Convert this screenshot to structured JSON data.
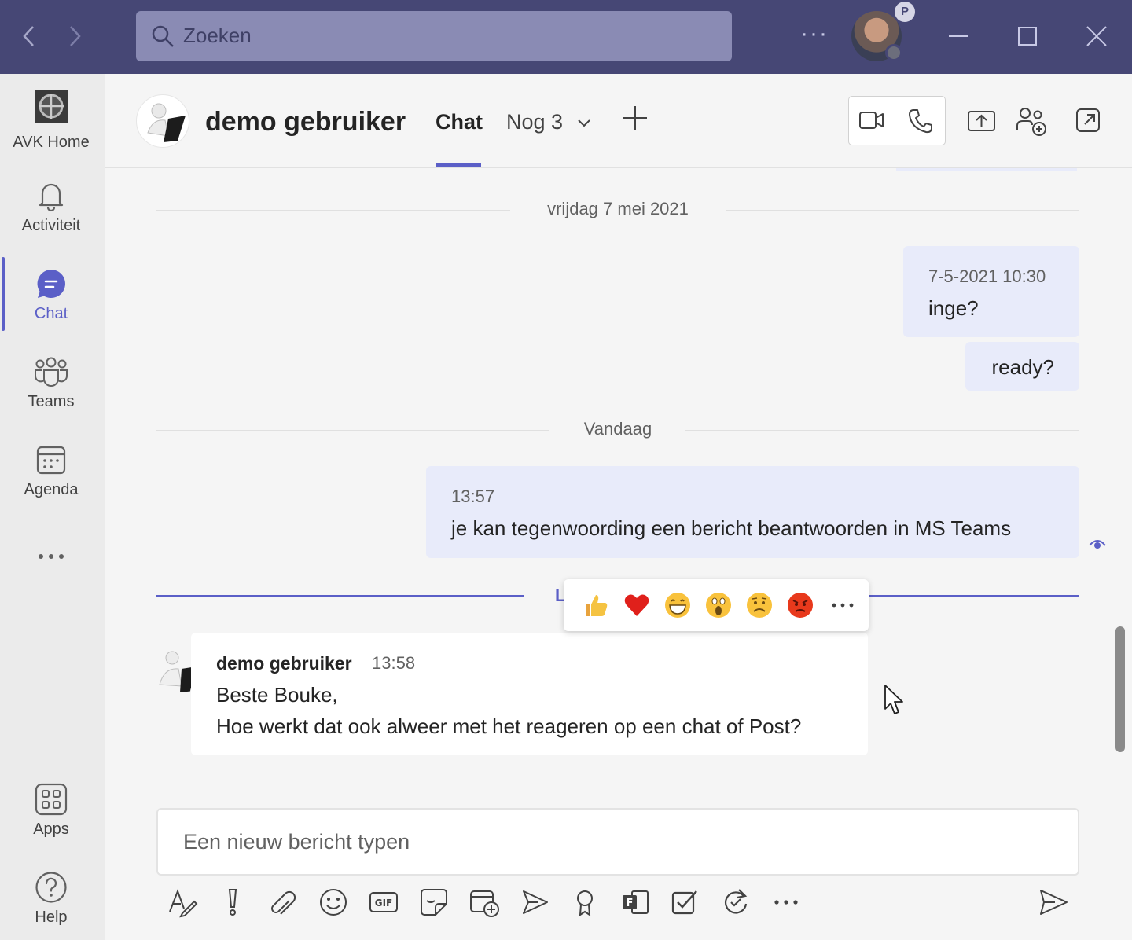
{
  "titlebar": {
    "search_placeholder": "Zoeken",
    "profile_badge": "P",
    "icons": [
      "back-arrow-icon",
      "forward-arrow-icon",
      "search-icon",
      "more-icon",
      "minimize-icon",
      "maximize-icon",
      "close-icon"
    ]
  },
  "rail": {
    "items": [
      {
        "label": "AVK Home",
        "icon": "avk-home-logo"
      },
      {
        "label": "Activiteit",
        "icon": "bell-icon"
      },
      {
        "label": "Chat",
        "icon": "chat-icon",
        "active": true
      },
      {
        "label": "Teams",
        "icon": "teams-icon"
      },
      {
        "label": "Agenda",
        "icon": "calendar-icon"
      },
      {
        "label": "",
        "icon": "more-icon"
      },
      {
        "label": "Apps",
        "icon": "apps-icon"
      },
      {
        "label": "Help",
        "icon": "help-icon"
      }
    ]
  },
  "header": {
    "contact_name": "demo gebruiker",
    "tab_chat": "Chat",
    "tab_more": "Nog 3",
    "tab_add": "+"
  },
  "conversation": {
    "date_1": "vrijdag 7 mei 2021",
    "msg_1_time": "7-5-2021 10:30",
    "msg_1_text": "inge?",
    "msg_2_text": "ready?",
    "date_2": "Vandaag",
    "msg_3_time": "13:57",
    "msg_3_text": "je kan tegenwoording een bericht beantwoorden in MS Teams",
    "new_label": "L",
    "reply_sender": "demo gebruiker",
    "reply_time": "13:58",
    "reply_line_1": "Beste Bouke,",
    "reply_line_2": "Hoe werkt dat ook alweer met het reageren op een chat of Post?"
  },
  "reactions": [
    "like",
    "heart",
    "laugh",
    "surprised",
    "sad",
    "angry",
    "more"
  ],
  "compose": {
    "placeholder": "Een nieuw bericht typen",
    "tools": [
      "format-icon",
      "important-icon",
      "attach-icon",
      "emoji-icon",
      "gif-icon",
      "sticker-icon",
      "meet-now-icon",
      "stream-icon",
      "praise-icon",
      "forms-icon",
      "tasks-icon",
      "loop-icon",
      "more-icon",
      "send-icon"
    ]
  },
  "colors": {
    "titlebar": "#464775",
    "accent": "#5b5fc7",
    "bubble_me": "#e8ebfa",
    "busy": "#c4314b"
  }
}
